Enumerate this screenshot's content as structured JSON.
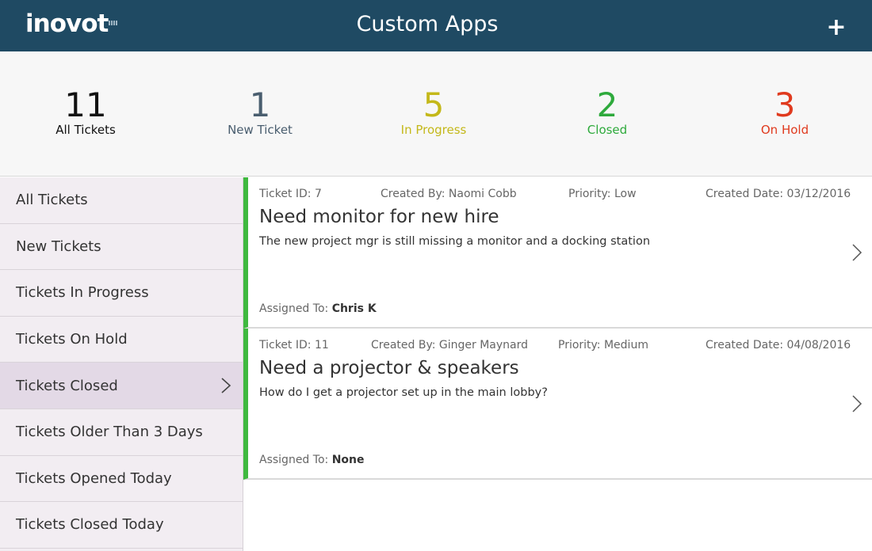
{
  "header": {
    "logo": "inovot",
    "title": "Custom Apps",
    "add_label": "+"
  },
  "stats": [
    {
      "count": "11",
      "label": "All Tickets",
      "color": "#111111"
    },
    {
      "count": "1",
      "label": "New Ticket",
      "color": "#4a5e6f"
    },
    {
      "count": "5",
      "label": "In Progress",
      "color": "#c4b81a"
    },
    {
      "count": "2",
      "label": "Closed",
      "color": "#2eaa3c"
    },
    {
      "count": "3",
      "label": "On Hold",
      "color": "#e03a1e"
    }
  ],
  "sidebar": {
    "items": [
      {
        "label": "All Tickets"
      },
      {
        "label": "New Tickets"
      },
      {
        "label": "Tickets In Progress"
      },
      {
        "label": "Tickets On Hold"
      },
      {
        "label": "Tickets Closed",
        "active": true
      },
      {
        "label": "Tickets Older Than 3 Days"
      },
      {
        "label": "Tickets Opened Today"
      },
      {
        "label": "Tickets Closed Today"
      }
    ]
  },
  "tickets": [
    {
      "id": "Ticket ID: 7",
      "created_by": "Created By: Naomi Cobb",
      "priority": "Priority: Low",
      "created_date": "Created Date: 03/12/2016",
      "title": "Need monitor for new hire",
      "description": "The new project mgr is still missing a monitor and a docking station",
      "assigned_label": "Assigned To:",
      "assigned_to": "Chris K"
    },
    {
      "id": "Ticket ID: 11",
      "created_by": "Created By: Ginger Maynard",
      "priority": "Priority: Medium",
      "created_date": "Created Date: 04/08/2016",
      "title": "Need a projector & speakers",
      "description": "How do I get a projector set up in the main lobby?",
      "assigned_label": "Assigned To:",
      "assigned_to": "None"
    }
  ],
  "colors": {
    "header_bg": "#1f4a63",
    "status_bar": "#3fb93f",
    "sidebar_bg": "#f2edf2",
    "sidebar_active": "#e3d9e6"
  },
  "icons": {
    "add": "plus-icon",
    "chevron": "chevron-right-icon"
  }
}
